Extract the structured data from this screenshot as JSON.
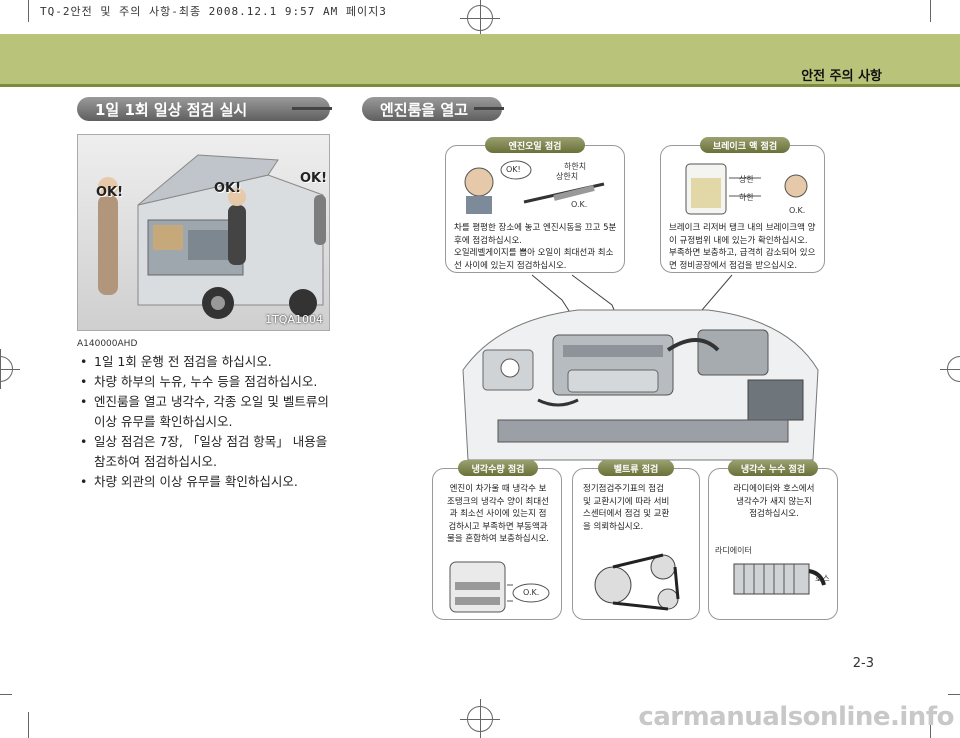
{
  "print_slug": "TQ-2안전 및 주의 사항-최종 2008.12.1 9:57 AM 페이지3",
  "header": {
    "title": "안전 주의 사항"
  },
  "left_section": {
    "title": "1일 1회 일상 점검 실시",
    "photo": {
      "ok_labels": [
        "OK!",
        "OK!",
        "OK!"
      ],
      "code": "1TQA1004"
    },
    "doc_code": "A140000AHD",
    "bullets": [
      "1일 1회 운행 전 점검을 하십시오.",
      "차량 하부의 누유, 누수 등을 점검하십시오.",
      "엔진룸을 열고 냉각수, 각종 오일 및 벨트류의 이상 유무를 확인하십시오.",
      "일상 점검은 7장, 「일상 점검 항목」 내용을 참조하여 점검하십시오.",
      "차량 외관의 이상 유무를 확인하십시오."
    ]
  },
  "right_section": {
    "title": "엔진룸을 열고",
    "engine_oil": {
      "title": "엔진오일 점검",
      "labels": {
        "ok": "OK!",
        "upper": "하한치",
        "lower": "상한치",
        "ok2": "O.K."
      },
      "text": [
        "차를 평평한 장소에 놓고 엔진시동을 끄고 5분",
        "후에 점검하십시오.",
        "오일레벨게이지를 뽑아 오일이 최대선과 최소",
        "선 사이에 있는지 점검하십시오."
      ]
    },
    "brake_fluid": {
      "title": "브레이크 액 점검",
      "labels": {
        "upper": "상한",
        "lower": "하한",
        "ok": "O.K."
      },
      "text": [
        "브레이크 리저버 탱크 내의 브레이크액 양",
        "이 규정범위 내에 있는가 확인하십시오.",
        "부족하면 보충하고, 급격히 감소되어 있으",
        "면 정비공장에서 점검을 받으십시오."
      ]
    },
    "coolant_level": {
      "title": "냉각수량 점검",
      "labels": {
        "ok": "O.K."
      },
      "text": [
        "엔진이 차가울 때 냉각수 보",
        "조탱크의 냉각수 양이 최대선",
        "과 최소선 사이에 있는지 점",
        "검하시고 부족하면 부동액과",
        "물을 혼합하여 보충하십시오."
      ]
    },
    "belt": {
      "title": "벨트류 점검",
      "text": [
        "정기점검주기표의 점검",
        "및 교환시기에 따라 서비",
        "스센터에서 점검 및 교환",
        "을 의뢰하십시오."
      ]
    },
    "coolant_leak": {
      "title": "냉각수 누수 점검",
      "labels": {
        "radiator": "라디에이터",
        "hose": "호스"
      },
      "text": [
        "라디에이터와 호스에서",
        "냉각수가 새지 않는지",
        "점검하십시오."
      ]
    }
  },
  "page_number": "2-3",
  "watermark": "carmanualsonline.info"
}
